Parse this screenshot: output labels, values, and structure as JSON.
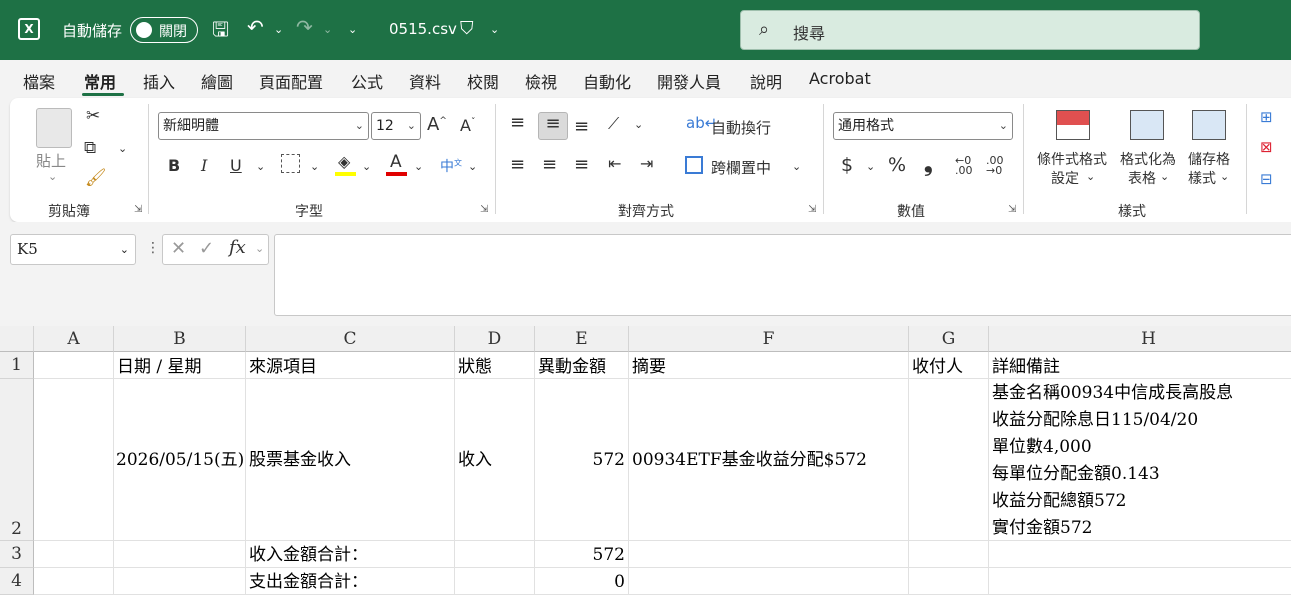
{
  "titlebar": {
    "app_icon": "excel-logo-icon",
    "autosave_label": "自動儲存",
    "autosave_state": "關閉",
    "filename": "0515.csv",
    "search_placeholder": "搜尋"
  },
  "tabs": [
    "檔案",
    "常用",
    "插入",
    "繪圖",
    "頁面配置",
    "公式",
    "資料",
    "校閱",
    "檢視",
    "自動化",
    "開發人員",
    "說明",
    "Acrobat"
  ],
  "active_tab": "常用",
  "ribbon": {
    "clipboard": {
      "paste": "貼上",
      "label": "剪貼簿"
    },
    "font": {
      "name": "新細明體",
      "size": "12",
      "label": "字型",
      "bold": "B",
      "italic": "I",
      "underline": "U"
    },
    "alignment": {
      "wrap": "自動換行",
      "merge": "跨欄置中",
      "label": "對齊方式"
    },
    "number": {
      "format": "通用格式",
      "currency": "$",
      "percent": "%",
      "comma": "❟",
      "label": "數值"
    },
    "styles": {
      "conditional_1": "條件式格式",
      "conditional_2": "設定",
      "table_1": "格式化為",
      "table_2": "表格",
      "cell_1": "儲存格",
      "cell_2": "樣式",
      "label": "樣式"
    }
  },
  "formula_bar": {
    "name_box": "K5",
    "fx": "fx",
    "formula": ""
  },
  "sheet": {
    "columns": [
      "A",
      "B",
      "C",
      "D",
      "E",
      "F",
      "G",
      "H"
    ],
    "rows": [
      "1",
      "2",
      "3",
      "4"
    ],
    "row1": {
      "b": "日期 / 星期",
      "c": "來源項目",
      "d": "狀態",
      "e": "異動金額",
      "f": "摘要",
      "g": "收付人",
      "h": "詳細備註"
    },
    "row2": {
      "b": "2026/05/15(五)",
      "c": "股票基金收入",
      "d": "收入",
      "e": "572",
      "f": "00934ETF基金收益分配$572",
      "h_lines": [
        "基金名稱00934中信成長高股息",
        "收益分配除息日115/04/20",
        "單位數4,000",
        "每單位分配金額0.143",
        "收益分配總額572",
        "實付金額572"
      ]
    },
    "row3": {
      "c": "收入金額合計：",
      "e": "572"
    },
    "row4": {
      "c": "支出金額合計：",
      "e": "0"
    }
  }
}
